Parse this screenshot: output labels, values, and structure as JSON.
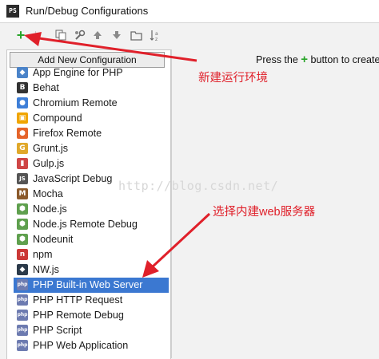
{
  "window": {
    "app_icon": "PS",
    "title": "Run/Debug Configurations"
  },
  "toolbar": {
    "add": "+",
    "icons": [
      "copy-icon",
      "settings-wrench-icon",
      "move-up-icon",
      "move-down-icon",
      "folder-icon",
      "sort-icon"
    ]
  },
  "popup": {
    "header": "Add New Configuration",
    "items": [
      {
        "label": "App Engine for PHP",
        "icon": "app-engine-icon",
        "color": "#4a83c9",
        "glyph": "◆"
      },
      {
        "label": "Behat",
        "icon": "behat-icon",
        "color": "#333333",
        "glyph": "B"
      },
      {
        "label": "Chromium Remote",
        "icon": "chromium-icon",
        "color": "#3e7fd8",
        "glyph": "●"
      },
      {
        "label": "Compound",
        "icon": "compound-icon",
        "color": "#f0a500",
        "glyph": "▣"
      },
      {
        "label": "Firefox Remote",
        "icon": "firefox-icon",
        "color": "#e5642a",
        "glyph": "●"
      },
      {
        "label": "Grunt.js",
        "icon": "grunt-icon",
        "color": "#e0a82a",
        "glyph": "G"
      },
      {
        "label": "Gulp.js",
        "icon": "gulp-icon",
        "color": "#cf4646",
        "glyph": "▮"
      },
      {
        "label": "JavaScript Debug",
        "icon": "javascript-debug-icon",
        "color": "#555555",
        "glyph": "JS"
      },
      {
        "label": "Mocha",
        "icon": "mocha-icon",
        "color": "#8b5a2b",
        "glyph": "M"
      },
      {
        "label": "Node.js",
        "icon": "nodejs-icon",
        "color": "#5fa04e",
        "glyph": "⬢"
      },
      {
        "label": "Node.js Remote Debug",
        "icon": "nodejs-remote-debug-icon",
        "color": "#5fa04e",
        "glyph": "⬢"
      },
      {
        "label": "Nodeunit",
        "icon": "nodeunit-icon",
        "color": "#5fa04e",
        "glyph": "⬢"
      },
      {
        "label": "npm",
        "icon": "npm-icon",
        "color": "#cb3837",
        "glyph": "n"
      },
      {
        "label": "NW.js",
        "icon": "nwjs-icon",
        "color": "#2b3a4a",
        "glyph": "◆"
      },
      {
        "label": "PHP Built-in Web Server",
        "icon": "php-builtin-server-icon",
        "color": "#6d7bb0",
        "glyph": "php",
        "selected": true
      },
      {
        "label": "PHP HTTP Request",
        "icon": "php-http-request-icon",
        "color": "#6d7bb0",
        "glyph": "php"
      },
      {
        "label": "PHP Remote Debug",
        "icon": "php-remote-debug-icon",
        "color": "#6d7bb0",
        "glyph": "php"
      },
      {
        "label": "PHP Script",
        "icon": "php-script-icon",
        "color": "#6d7bb0",
        "glyph": "php"
      },
      {
        "label": "PHP Web Application",
        "icon": "php-web-application-icon",
        "color": "#6d7bb0",
        "glyph": "php"
      }
    ]
  },
  "right": {
    "hint_prefix": "Press the",
    "hint_plus": "+",
    "hint_suffix": "button to create"
  },
  "annotations": {
    "note_new": "新建运行环境",
    "note_select": "选择内建web服务器",
    "watermark": "http://blog.csdn.net/",
    "arrow_color": "#e0202a"
  }
}
